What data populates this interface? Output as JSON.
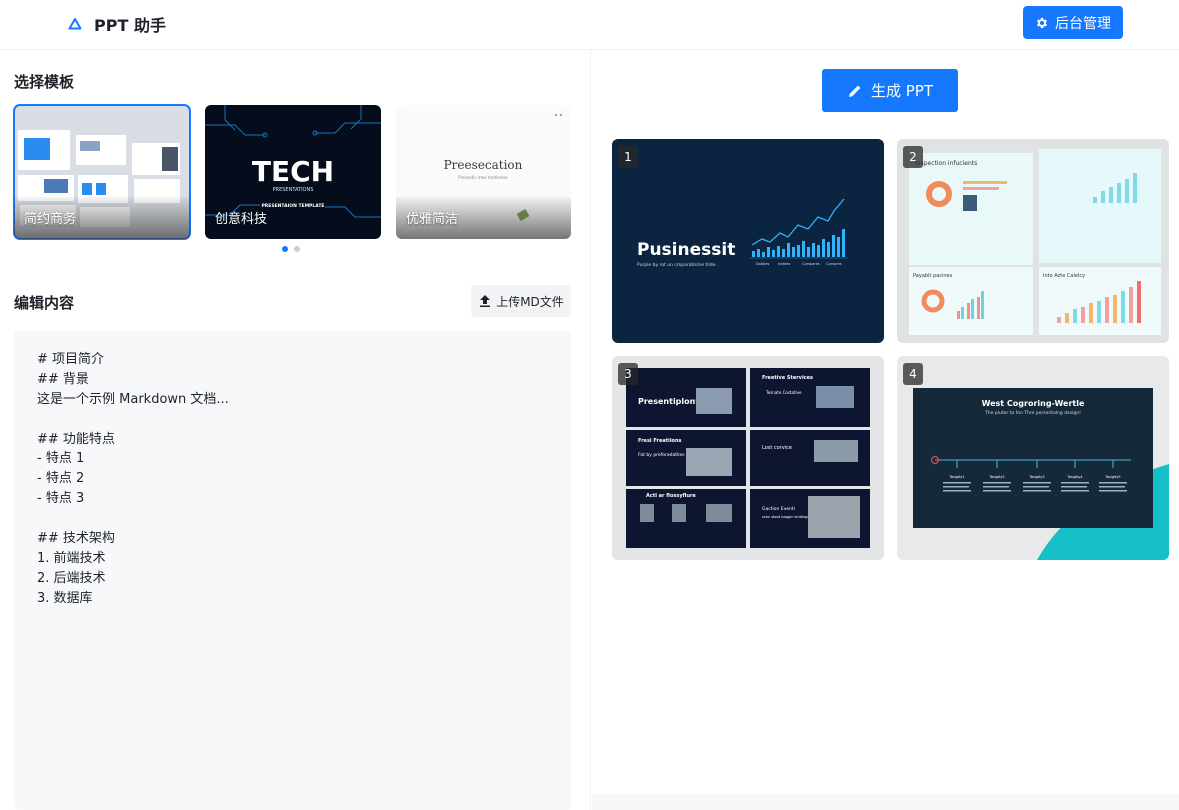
{
  "header": {
    "app_title": "PPT 助手",
    "admin_label": "后台管理",
    "logo_icon": "triangle-logo-icon",
    "admin_icon": "gear-icon",
    "accent": "#1677ff"
  },
  "templates": {
    "section_title": "选择模板",
    "items": [
      {
        "label": "简约商务",
        "selected": true
      },
      {
        "label": "创意科技",
        "selected": false,
        "cover_title": "TECH",
        "cover_subtitle": "PRESENTATIONS",
        "cover_caption": "PRESENTAION TEMPLATE"
      },
      {
        "label": "优雅简洁",
        "selected": false,
        "cover_title": "Preesecation",
        "cover_subtitle": "Presentic mee tentiertee"
      }
    ],
    "page_dots": 2,
    "active_dot": 0
  },
  "editor": {
    "section_title": "编辑内容",
    "upload_label": "上传MD文件",
    "upload_icon": "upload-icon",
    "lines": [
      "# 项目简介",
      "## 背景",
      "这是一个示例 Markdown 文档...",
      "",
      "## 功能特点",
      "- 特点 1",
      "- 特点 2",
      "- 特点 3",
      "",
      "## 技术架构",
      "1. 前端技术",
      "2. 后端技术",
      "3. 数据库"
    ]
  },
  "preview": {
    "generate_label": "生成 PPT",
    "generate_icon": "pencil-icon",
    "slides": [
      {
        "number": "1",
        "title": "Pusinessit",
        "subtitle": "Purple by rot un cmparatisme tilde.",
        "axis": [
          "Dotibes",
          "Indttes",
          "Compares",
          "Compres"
        ]
      },
      {
        "number": "2",
        "title": "Inspection infucients",
        "panel_a": "Payablt pacines",
        "panel_b": "Into Azte Calelcy"
      },
      {
        "number": "3",
        "title": "Presentiplont",
        "panel_a": "Freetive Stervices",
        "panel_b": "Tesnate Costative",
        "panel_c": "Fresi Freatiions",
        "panel_d": "Fot by preforadatlies",
        "panel_e": "Lost corvice",
        "panel_f": "Actl ar flossyflure",
        "panel_g": "Gaction Eventi",
        "panel_h": "scen stssd baggin smdingsts an Lonets"
      },
      {
        "number": "4",
        "title": "West Cogroring-Wertle",
        "subtitle": "The piuter to fon Thre persentalng design!",
        "steps": [
          "Tosigity1",
          "Tosigity2",
          "Tosigity3",
          "Tosigity4",
          "Tosigity5"
        ]
      }
    ]
  }
}
